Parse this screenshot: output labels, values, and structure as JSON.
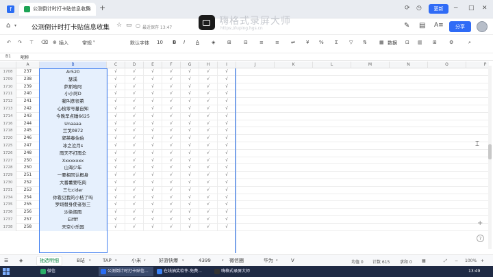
{
  "browser": {
    "tab_title": "公测倒计时打卡贴信息收集",
    "tab_close": "×",
    "new_tab": "+",
    "update_label": "更新"
  },
  "watermark": {
    "title": "嗨格式录屏大师",
    "url": "https://luping.hgs.cn"
  },
  "doc": {
    "title": "公测倒计时打卡贴信息收集",
    "saved_text": "最近保存 13:47",
    "share_label": "分享"
  },
  "toolbar": {
    "insert": "插入",
    "style": "常规",
    "font": "默认字体",
    "size": "10",
    "bold": "B",
    "italic": "I",
    "filter": "▽",
    "data": "数据"
  },
  "formula": {
    "cell_ref": "B1",
    "content": "昵称"
  },
  "columns": [
    "A",
    "B",
    "C",
    "D",
    "E",
    "F",
    "G",
    "H",
    "I",
    "J",
    "K",
    "L",
    "M",
    "N",
    "O",
    "P"
  ],
  "rows": [
    {
      "rn": "1708",
      "a": "237",
      "b": "Ar520"
    },
    {
      "rn": "1709",
      "a": "238",
      "b": "瑟溪"
    },
    {
      "rn": "1710",
      "a": "239",
      "b": "萨斯哈阿"
    },
    {
      "rn": "1711",
      "a": "240",
      "b": "小小阿D"
    },
    {
      "rn": "1712",
      "a": "241",
      "b": "我叫彦很弟"
    },
    {
      "rn": "1713",
      "a": "242",
      "b": "心梳零号蔓自知"
    },
    {
      "rn": "1714",
      "a": "243",
      "b": "今晚早点睡6625"
    },
    {
      "rn": "1716",
      "a": "244",
      "b": "Unaaaa"
    },
    {
      "rn": "1718",
      "a": "245",
      "b": "兰戈0872"
    },
    {
      "rn": "1720",
      "a": "246",
      "b": "郭英春伯伯"
    },
    {
      "rn": "1725",
      "a": "247",
      "b": "冰之泣月s"
    },
    {
      "rn": "1726",
      "a": "248",
      "b": "雨天不打雨伞"
    },
    {
      "rn": "1727",
      "a": "250",
      "b": "Xxxxxxxx"
    },
    {
      "rn": "1728",
      "a": "250",
      "b": "山海少年"
    },
    {
      "rn": "1729",
      "a": "251",
      "b": "一要相同认概身"
    },
    {
      "rn": "1730",
      "a": "252",
      "b": "大番薯要吃肉"
    },
    {
      "rn": "1731",
      "a": "253",
      "b": "三七cider"
    },
    {
      "rn": "1734",
      "a": "254",
      "b": "你看见我的小桔了吗"
    },
    {
      "rn": "1735",
      "a": "255",
      "b": "罗翊替身使者张三"
    },
    {
      "rn": "1736",
      "a": "256",
      "b": "沙染烟雨"
    },
    {
      "rn": "1737",
      "a": "257",
      "b": "Eiffff"
    },
    {
      "rn": "1738",
      "a": "258",
      "b": "天空小乐园"
    }
  ],
  "check_mark": "√",
  "sheets": [
    "抽选明细",
    "B站",
    "TAP",
    "小米",
    "好游快爆",
    "4399",
    "微信圈",
    "华为",
    "V"
  ],
  "status": {
    "avg": "均值 0",
    "count": "计数 615",
    "sum": "求和 0",
    "zoom": "100%"
  },
  "taskbar": {
    "items": [
      {
        "label": "微信",
        "color": "#2aae67"
      },
      {
        "label": "公测倒计时打卡贴信...",
        "color": "#2a6df4"
      },
      {
        "label": "在线抽奖软件-免费...",
        "color": "#3b82f6"
      },
      {
        "label": "嗨格式录屏大师",
        "color": "#333333"
      }
    ],
    "clock": "13:49"
  }
}
